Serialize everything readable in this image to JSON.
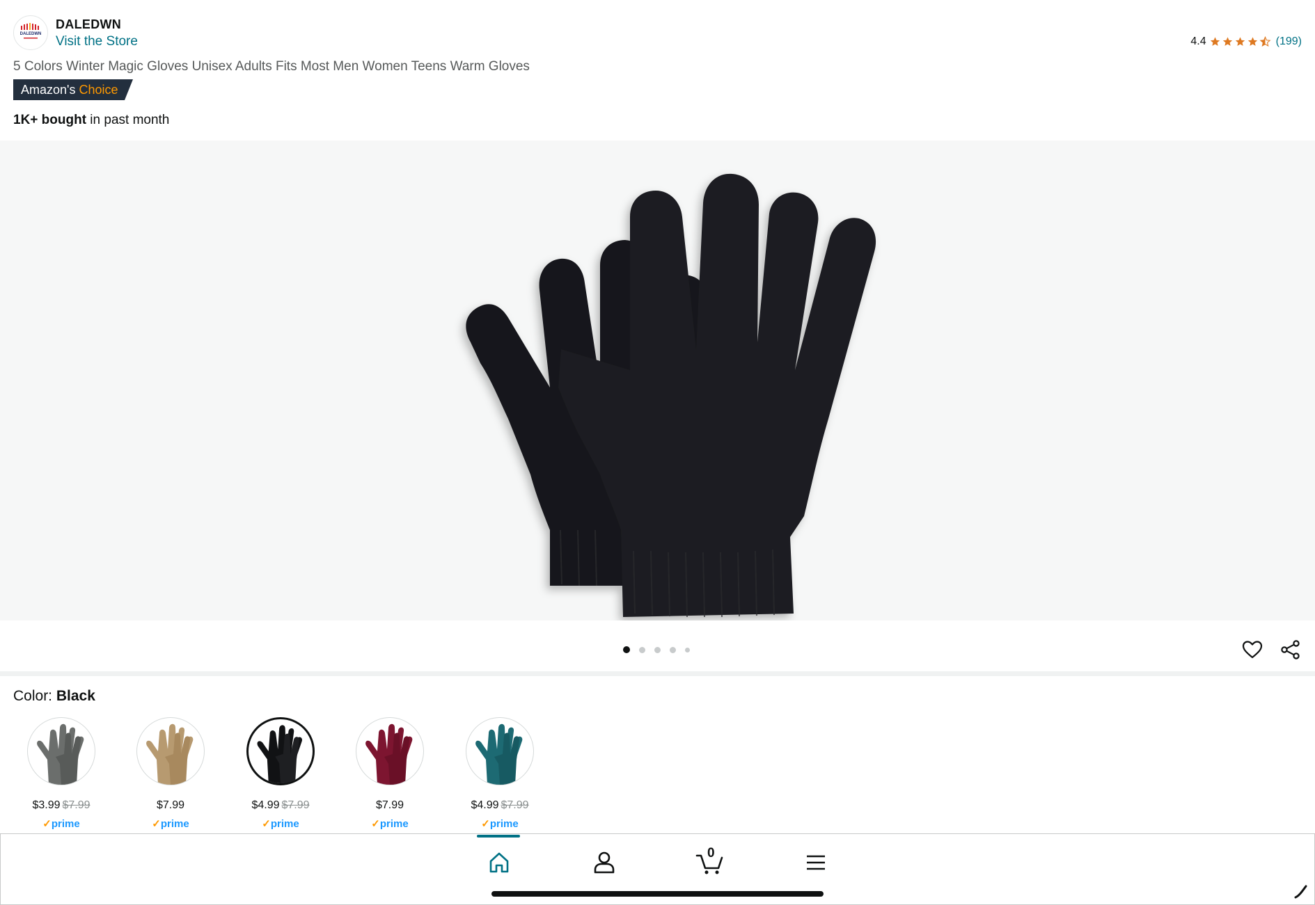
{
  "brand": {
    "name": "DALEDWN",
    "visit_store": "Visit the Store",
    "logo_text": "DALEDWN"
  },
  "rating": {
    "value": "4.4",
    "stars": 4.4,
    "count": "(199)",
    "star_color": "#de7921"
  },
  "product": {
    "title": "5 Colors Winter Magic Gloves Unisex Adults Fits Most Men Women Teens Warm Gloves",
    "badge_prefix": "Amazon's",
    "badge_highlight": "Choice",
    "bought_bold": "1K+ bought",
    "bought_rest": " in past month"
  },
  "gallery": {
    "image_icon": "black-knit-gloves-image",
    "dots_total": 5,
    "active_dot": 0
  },
  "actions": {
    "wishlist_icon": "heart-icon",
    "share_icon": "share-icon"
  },
  "color": {
    "label": "Color: ",
    "selected": "Black"
  },
  "swatches": [
    {
      "name": "Gray",
      "price": "$3.99",
      "list_price": "$7.99",
      "prime": "prime",
      "color": "#6b6e6c"
    },
    {
      "name": "Khaki",
      "price": "$7.99",
      "list_price": "",
      "prime": "prime",
      "color": "#b79a70"
    },
    {
      "name": "Black",
      "price": "$4.99",
      "list_price": "$7.99",
      "prime": "prime",
      "color": "#111214"
    },
    {
      "name": "Burgundy",
      "price": "$7.99",
      "list_price": "",
      "prime": "prime",
      "color": "#7d1530"
    },
    {
      "name": "Teal",
      "price": "$4.99",
      "list_price": "$7.99",
      "prime": "prime",
      "color": "#1d6a73"
    }
  ],
  "nav": {
    "home_icon": "home-icon",
    "account_icon": "account-icon",
    "cart_icon": "cart-icon",
    "cart_count": "0",
    "menu_icon": "menu-icon"
  },
  "colors": {
    "link": "#007185",
    "accent_orange": "#ff9900",
    "prime_blue": "#1a98ff",
    "badge_bg": "#232f3e"
  }
}
